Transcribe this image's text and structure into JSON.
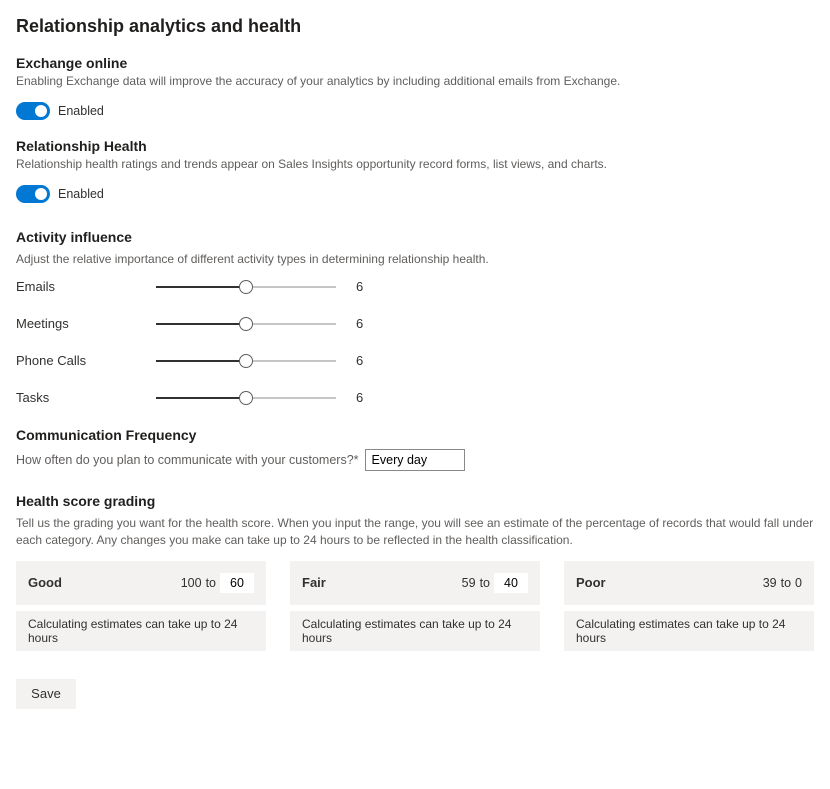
{
  "page": {
    "title": "Relationship analytics and health"
  },
  "exchange": {
    "title": "Exchange online",
    "desc": "Enabling Exchange data will improve the accuracy of your analytics by including additional emails from Exchange.",
    "toggle_label": "Enabled",
    "enabled": true
  },
  "health": {
    "title": "Relationship Health",
    "desc": "Relationship health ratings and trends appear on Sales Insights opportunity record forms, list views, and charts.",
    "toggle_label": "Enabled",
    "enabled": true
  },
  "activity": {
    "title": "Activity influence",
    "desc": "Adjust the relative importance of different activity types in determining relationship health.",
    "max": 12,
    "rows": [
      {
        "label": "Emails",
        "value": 6
      },
      {
        "label": "Meetings",
        "value": 6
      },
      {
        "label": "Phone Calls",
        "value": 6
      },
      {
        "label": "Tasks",
        "value": 6
      }
    ]
  },
  "comm_freq": {
    "title": "Communication Frequency",
    "label": "How often do you plan to communicate with your customers?*",
    "value": "Every day"
  },
  "grading": {
    "title": "Health score grading",
    "desc": "Tell us the grading you want for the health score. When you input the range, you will see an estimate of the percentage of records that would fall under each category. Any changes you make can take up to 24 hours to be reflected in the health classification.",
    "estimate_note": "Calculating estimates can take up to 24 hours",
    "good": {
      "name": "Good",
      "high": "100",
      "low": "60",
      "to": "to"
    },
    "fair": {
      "name": "Fair",
      "high": "59",
      "low": "40",
      "to": "to"
    },
    "poor": {
      "name": "Poor",
      "high": "39",
      "low": "0",
      "to": "to"
    }
  },
  "save": {
    "label": "Save"
  }
}
